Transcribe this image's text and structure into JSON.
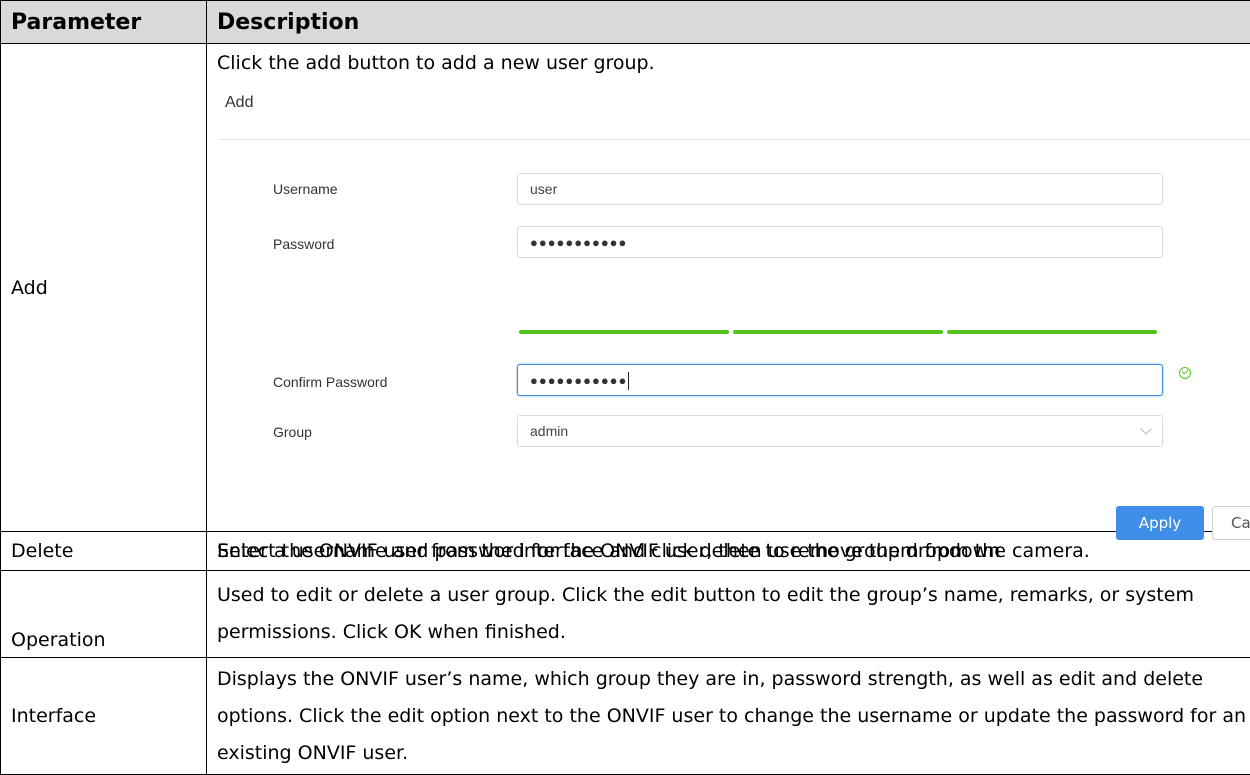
{
  "table": {
    "header_param": "Parameter",
    "header_desc": "Description",
    "rows": {
      "add": {
        "param": "Add",
        "intro": "Click the add button to add a new user group.",
        "outro": "Enter a username and password for the ONVIF user, then use the group dropdown"
      },
      "delete": {
        "param": "Delete",
        "desc": "Select the ONVIF user from the interface and click delete to remove them from the camera."
      },
      "operation": {
        "param": "Operation",
        "desc": "Used to edit or delete a user group. Click the edit button to edit the group’s name, remarks, or system permissions. Click OK when finished."
      },
      "interface": {
        "param": "Interface",
        "desc": "Displays the ONVIF user’s name, which group they are in, password strength, as well as edit and delete options. Click the edit option next to the ONVIF user to change the username or update the password for an existing ONVIF user."
      }
    }
  },
  "dialog": {
    "title": "Add",
    "username_label": "Username",
    "username_value": "user",
    "password_label": "Password",
    "password_value": "●●●●●●●●●●●",
    "confirm_label": "Confirm Password",
    "confirm_value": "●●●●●●●●●●●",
    "group_label": "Group",
    "group_value": "admin",
    "apply_label": "Apply",
    "cancel_label": "Can",
    "strength_segments": 3,
    "colors": {
      "accent": "#3f8ee8",
      "strength": "#52c41a"
    }
  }
}
